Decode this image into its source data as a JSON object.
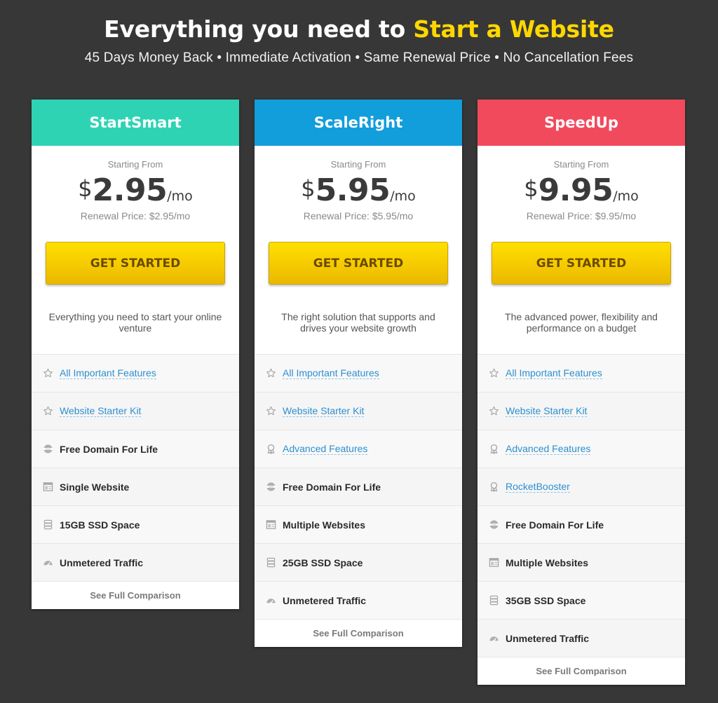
{
  "header": {
    "title_main": "Everything you need to ",
    "title_highlight": "Start a Website",
    "subtitle": "45 Days Money Back • Immediate Activation • Same Renewal Price • No Cancellation Fees"
  },
  "colors": {
    "background": "#373737",
    "highlight": "#ffd700",
    "startsmart": "#2ed3b4",
    "scaleright": "#129ddb",
    "speedup": "#f14a5d",
    "cta": "#f4c800",
    "link": "#2c8fd0"
  },
  "plans": [
    {
      "name": "StartSmart",
      "starting_label": "Starting From",
      "currency": "$",
      "amount": "2.95",
      "period": "/mo",
      "renewal": "Renewal Price: $2.95/mo",
      "cta": "GET STARTED",
      "description": "Everything you need to start your online venture",
      "features": [
        {
          "icon": "star-icon",
          "label": "All Important Features",
          "style": "link"
        },
        {
          "icon": "star-icon",
          "label": "Website Starter Kit",
          "style": "link"
        },
        {
          "icon": "domain-icon",
          "label": "Free Domain For Life",
          "style": "bold"
        },
        {
          "icon": "website-icon",
          "label": "Single Website",
          "style": "bold"
        },
        {
          "icon": "database-icon",
          "label": "15GB SSD Space",
          "style": "bold"
        },
        {
          "icon": "speedometer-icon",
          "label": "Unmetered Traffic",
          "style": "bold"
        }
      ],
      "compare": "See Full Comparison"
    },
    {
      "name": "ScaleRight",
      "starting_label": "Starting From",
      "currency": "$",
      "amount": "5.95",
      "period": "/mo",
      "renewal": "Renewal Price: $5.95/mo",
      "cta": "GET STARTED",
      "description": "The right solution that supports and drives your website growth",
      "features": [
        {
          "icon": "star-icon",
          "label": "All Important Features",
          "style": "link"
        },
        {
          "icon": "star-icon",
          "label": "Website Starter Kit",
          "style": "link"
        },
        {
          "icon": "award-icon",
          "label": "Advanced Features",
          "style": "link"
        },
        {
          "icon": "domain-icon",
          "label": "Free Domain For Life",
          "style": "bold"
        },
        {
          "icon": "website-icon",
          "label": "Multiple Websites",
          "style": "bold"
        },
        {
          "icon": "database-icon",
          "label": "25GB SSD Space",
          "style": "bold"
        },
        {
          "icon": "speedometer-icon",
          "label": "Unmetered Traffic",
          "style": "bold"
        }
      ],
      "compare": "See Full Comparison"
    },
    {
      "name": "SpeedUp",
      "starting_label": "Starting From",
      "currency": "$",
      "amount": "9.95",
      "period": "/mo",
      "renewal": "Renewal Price: $9.95/mo",
      "cta": "GET STARTED",
      "description": "The advanced power, flexibility and performance on a budget",
      "features": [
        {
          "icon": "star-icon",
          "label": "All Important Features",
          "style": "link"
        },
        {
          "icon": "star-icon",
          "label": "Website Starter Kit",
          "style": "link"
        },
        {
          "icon": "award-icon",
          "label": "Advanced Features",
          "style": "link"
        },
        {
          "icon": "award-icon",
          "label": "RocketBooster",
          "style": "link"
        },
        {
          "icon": "domain-icon",
          "label": "Free Domain For Life",
          "style": "bold"
        },
        {
          "icon": "website-icon",
          "label": "Multiple Websites",
          "style": "bold"
        },
        {
          "icon": "database-icon",
          "label": "35GB SSD Space",
          "style": "bold"
        },
        {
          "icon": "speedometer-icon",
          "label": "Unmetered Traffic",
          "style": "bold"
        }
      ],
      "compare": "See Full Comparison"
    }
  ]
}
